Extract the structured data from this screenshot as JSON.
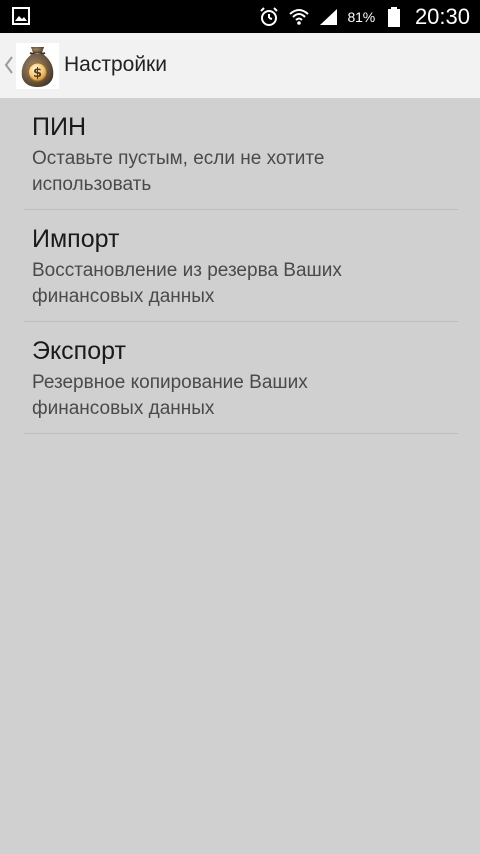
{
  "status_bar": {
    "notification_icon": "image-icon",
    "alarm_icon": "alarm-clock-icon",
    "wifi_icon": "wifi-icon",
    "signal_icon": "cell-signal-icon",
    "battery_percent": "81%",
    "battery_icon": "battery-icon",
    "time": "20:30"
  },
  "action_bar": {
    "back_icon": "chevron-left-icon",
    "logo_icon": "money-bag-icon",
    "title": "Настройки"
  },
  "settings": {
    "items": [
      {
        "title": "ПИН",
        "summary": "Оставьте пустым, если не хотите использовать"
      },
      {
        "title": "Импорт",
        "summary": "Восстановление из резерва Ваших финансовых данных"
      },
      {
        "title": "Экспорт",
        "summary": "Резервное копирование Ваших финансовых данных"
      }
    ]
  },
  "colors": {
    "status_bar_bg": "#000000",
    "action_bar_bg": "#f2f2f2",
    "content_bg": "#d0d0d0",
    "divider": "#bdbdbd"
  }
}
